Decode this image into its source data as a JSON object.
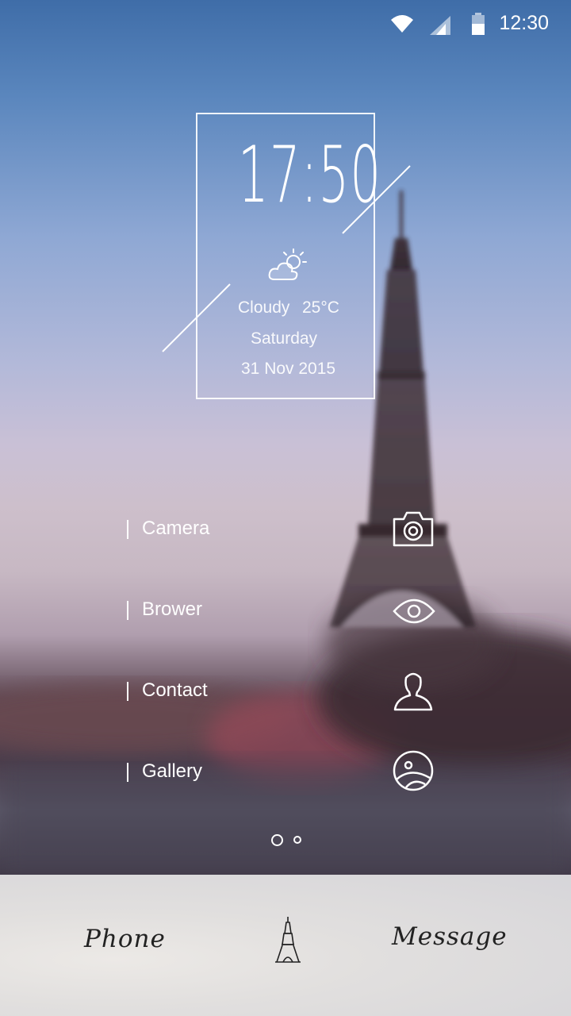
{
  "status_bar": {
    "time": "12:30",
    "icons": [
      "wifi-icon",
      "signal-icon",
      "battery-icon"
    ]
  },
  "widget": {
    "time": "17:50",
    "weather_icon": "partly-cloudy-icon",
    "condition": "Cloudy",
    "temperature": "25°C",
    "day": "Saturday",
    "date": "31 Nov 2015"
  },
  "apps": [
    {
      "label": "Camera",
      "icon": "camera-icon"
    },
    {
      "label": "Brower",
      "icon": "eye-icon"
    },
    {
      "label": "Contact",
      "icon": "person-icon"
    },
    {
      "label": "Gallery",
      "icon": "gallery-icon"
    }
  ],
  "pager": {
    "pages": 2,
    "current": 1
  },
  "dock": {
    "left_label": "Phone",
    "center_icon": "eiffel-tower-icon",
    "right_label": "Message"
  },
  "colors": {
    "accent": "#ffffff",
    "dock_text": "#222222"
  }
}
